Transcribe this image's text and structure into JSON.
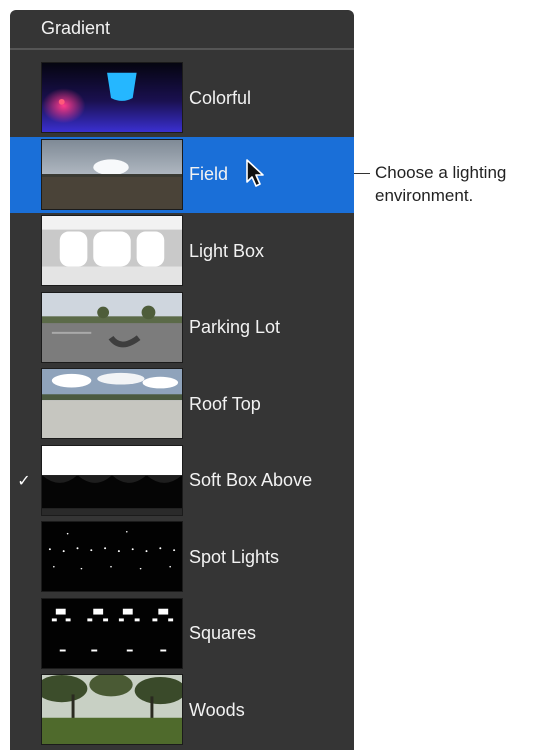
{
  "menu": {
    "header": "Gradient",
    "items": [
      {
        "label": "Colorful",
        "thumbnail": "colorful-thumbnail",
        "selected": false,
        "checked": false
      },
      {
        "label": "Field",
        "thumbnail": "field-thumbnail",
        "selected": true,
        "checked": false
      },
      {
        "label": "Light Box",
        "thumbnail": "light-box-thumbnail",
        "selected": false,
        "checked": false
      },
      {
        "label": "Parking Lot",
        "thumbnail": "parking-lot-thumbnail",
        "selected": false,
        "checked": false
      },
      {
        "label": "Roof Top",
        "thumbnail": "roof-top-thumbnail",
        "selected": false,
        "checked": false
      },
      {
        "label": "Soft Box Above",
        "thumbnail": "soft-box-above-thumbnail",
        "selected": false,
        "checked": true
      },
      {
        "label": "Spot Lights",
        "thumbnail": "spot-lights-thumbnail",
        "selected": false,
        "checked": false
      },
      {
        "label": "Squares",
        "thumbnail": "squares-thumbnail",
        "selected": false,
        "checked": false
      },
      {
        "label": "Woods",
        "thumbnail": "woods-thumbnail",
        "selected": false,
        "checked": false
      }
    ],
    "checkmark": "✓"
  },
  "callout": {
    "text": "Choose a lighting environment."
  },
  "colors": {
    "menu_background": "#353535",
    "selection": "#1a6fd8",
    "text": "#f2f2f2"
  }
}
